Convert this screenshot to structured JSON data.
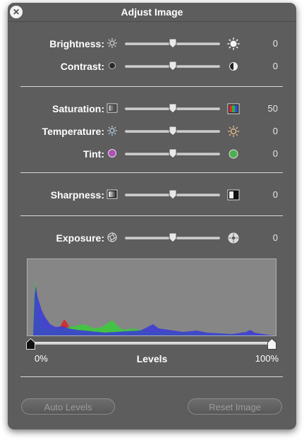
{
  "window": {
    "title": "Adjust Image"
  },
  "rows": {
    "brightness": {
      "label": "Brightness:",
      "value": "0",
      "level": 0.5
    },
    "contrast": {
      "label": "Contrast:",
      "value": "0",
      "level": 0.5
    },
    "saturation": {
      "label": "Saturation:",
      "value": "50",
      "level": 0.5
    },
    "temperature": {
      "label": "Temperature:",
      "value": "0",
      "level": 0.5
    },
    "tint": {
      "label": "Tint:",
      "value": "0",
      "level": 0.5
    },
    "sharpness": {
      "label": "Sharpness:",
      "value": "0",
      "level": 0.5
    },
    "exposure": {
      "label": "Exposure:",
      "value": "0",
      "level": 0.5
    }
  },
  "levels": {
    "label": "Levels",
    "min_label": "0%",
    "max_label": "100%",
    "black_point": 0,
    "white_point": 1
  },
  "buttons": {
    "auto_levels": "Auto Levels",
    "reset_image": "Reset Image"
  },
  "icons": {
    "close": "close-icon",
    "brightness_low": "sun-small-icon",
    "brightness_high": "sun-large-icon",
    "contrast_low": "contrast-low-icon",
    "contrast_high": "contrast-high-icon",
    "saturation_low": "grayscale-swatch-icon",
    "saturation_high": "color-swatch-icon",
    "temperature_low": "cool-sun-icon",
    "temperature_high": "warm-sun-icon",
    "tint_low": "magenta-circle-icon",
    "tint_high": "green-circle-icon",
    "sharpness_low": "soft-square-icon",
    "sharpness_high": "sharp-square-icon",
    "exposure_low": "aperture-open-icon",
    "exposure_high": "aperture-closed-icon"
  },
  "colors": {
    "panel": "#5d5d5d",
    "histogram_bg": "#868686",
    "hist_red": "#d62828",
    "hist_green": "#3ec93e",
    "hist_blue": "#3a3ad8",
    "tint_magenta": "#b04fb5",
    "tint_green": "#4caf50"
  }
}
